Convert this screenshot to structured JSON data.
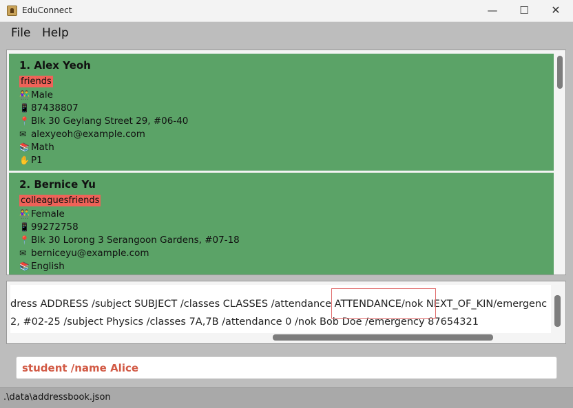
{
  "window": {
    "title": "EduConnect",
    "minimize": "—",
    "maximize": "☐",
    "close": "✕"
  },
  "menu": {
    "file": "File",
    "help": "Help"
  },
  "persons": [
    {
      "name": "1.  Alex Yeoh",
      "tag": "friends",
      "gender": "Male",
      "phone": "87438807",
      "address": "Blk 30 Geylang Street 29, #06-40",
      "email": "alexyeoh@example.com",
      "subject": "Math",
      "classes": "P1"
    },
    {
      "name": "2.  Bernice Yu",
      "tag": "colleaguesfriends",
      "gender": "Female",
      "phone": "99272758",
      "address": "Blk 30 Lorong 3 Serangoon Gardens, #07-18",
      "email": "berniceyu@example.com",
      "subject": "English"
    }
  ],
  "icons": {
    "gender": "👫",
    "phone": "📱",
    "address": "📍",
    "email": "✉",
    "subject": "📚",
    "classes": "✋"
  },
  "result": {
    "line1": "dress ADDRESS /subject SUBJECT /classes CLASSES /attendance ATTENDANCE/nok NEXT_OF_KIN/emergenc",
    "line2": "2, #02-25 /subject Physics /classes 7A,7B /attendance 0 /nok Bob Doe /emergency 87654321"
  },
  "command": {
    "value": "student /name Alice"
  },
  "status": {
    "path": ".\\data\\addressbook.json"
  },
  "colors": {
    "card": "#5ba367",
    "tag": "#ef6258",
    "command_text": "#d25a45",
    "highlight": "#e06a6a"
  }
}
